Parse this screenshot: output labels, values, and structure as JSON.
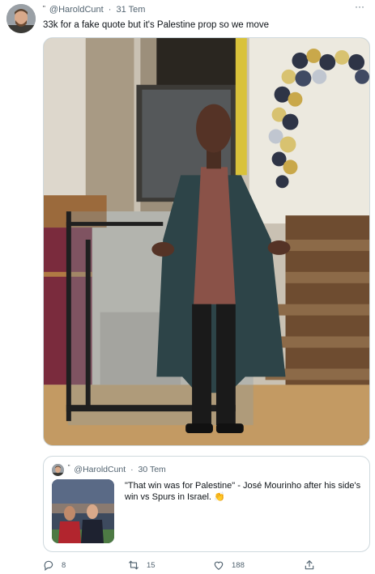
{
  "tweet": {
    "name_glyph": "\"",
    "handle": "@HaroldCunt",
    "separator": "·",
    "date": "31 Tem",
    "more": "···",
    "text": "33k for a fake quote but it's Palestine prop so we move"
  },
  "quoted": {
    "name_glyph": "\"",
    "handle": "@HaroldCunt",
    "separator": "·",
    "date": "30 Tem",
    "text": "\"That win was for Palestine\" - José Mourinho after his side's win vs Spurs in Israel.",
    "emoji": "👏"
  },
  "actions": {
    "replies": "8",
    "retweets": "15",
    "likes": "188"
  },
  "icons": {
    "more": "more-dots-icon",
    "reply": "reply-icon",
    "retweet": "retweet-icon",
    "like": "heart-icon",
    "share": "share-icon"
  },
  "colors": {
    "text": "#0f1419",
    "secondary": "#536471",
    "border": "#cfd9de"
  }
}
